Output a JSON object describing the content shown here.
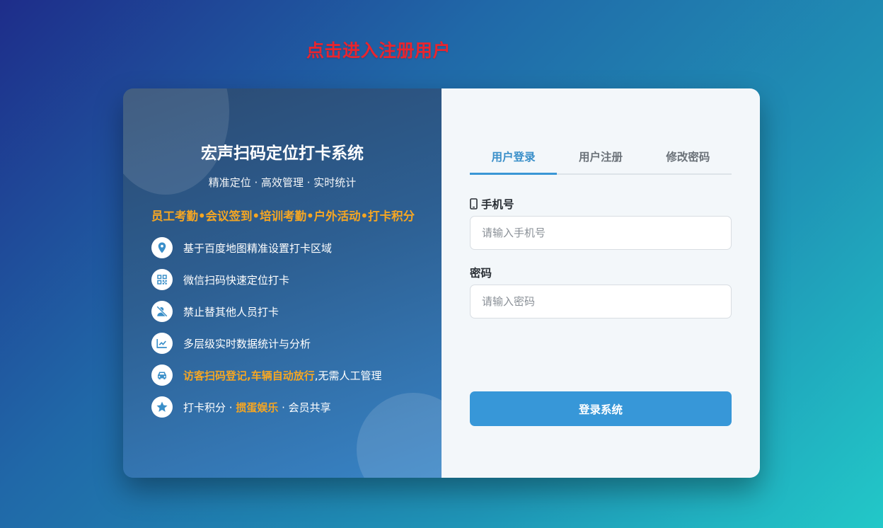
{
  "header": {
    "register_link": "点击进入注册用户"
  },
  "intro": {
    "title": "宏声扫码定位打卡系统",
    "subtitle": "精准定位 · 高效管理 · 实时统计",
    "highlight": "员工考勤•会议签到•培训考勤•户外活动•打卡积分",
    "features": [
      {
        "icon": "location-pin-icon",
        "text": "基于百度地图精准设置打卡区域"
      },
      {
        "icon": "qr-code-icon",
        "text": "微信扫码快速定位打卡"
      },
      {
        "icon": "user-slash-icon",
        "text": "禁止替其他人员打卡"
      },
      {
        "icon": "chart-line-icon",
        "text": "多层级实时数据统计与分析"
      },
      {
        "icon": "car-icon",
        "text_highlight": "访客扫码登记,车辆自动放行",
        "text_rest": ",无需人工管理"
      },
      {
        "icon": "star-icon",
        "text_pre": "打卡积分 · ",
        "text_highlight": "掼蛋娱乐",
        "text_post": " · 会员共享"
      }
    ]
  },
  "login": {
    "tabs": [
      {
        "label": "用户登录",
        "active": true
      },
      {
        "label": "用户注册",
        "active": false
      },
      {
        "label": "修改密码",
        "active": false
      }
    ],
    "phone": {
      "label": "手机号",
      "placeholder": "请输入手机号",
      "value": ""
    },
    "password": {
      "label": "密码",
      "placeholder": "请输入密码",
      "value": ""
    },
    "submit_label": "登录系统"
  },
  "colors": {
    "accent": "#3797d8",
    "highlight": "#f5a623",
    "register_link": "#e8252f"
  }
}
